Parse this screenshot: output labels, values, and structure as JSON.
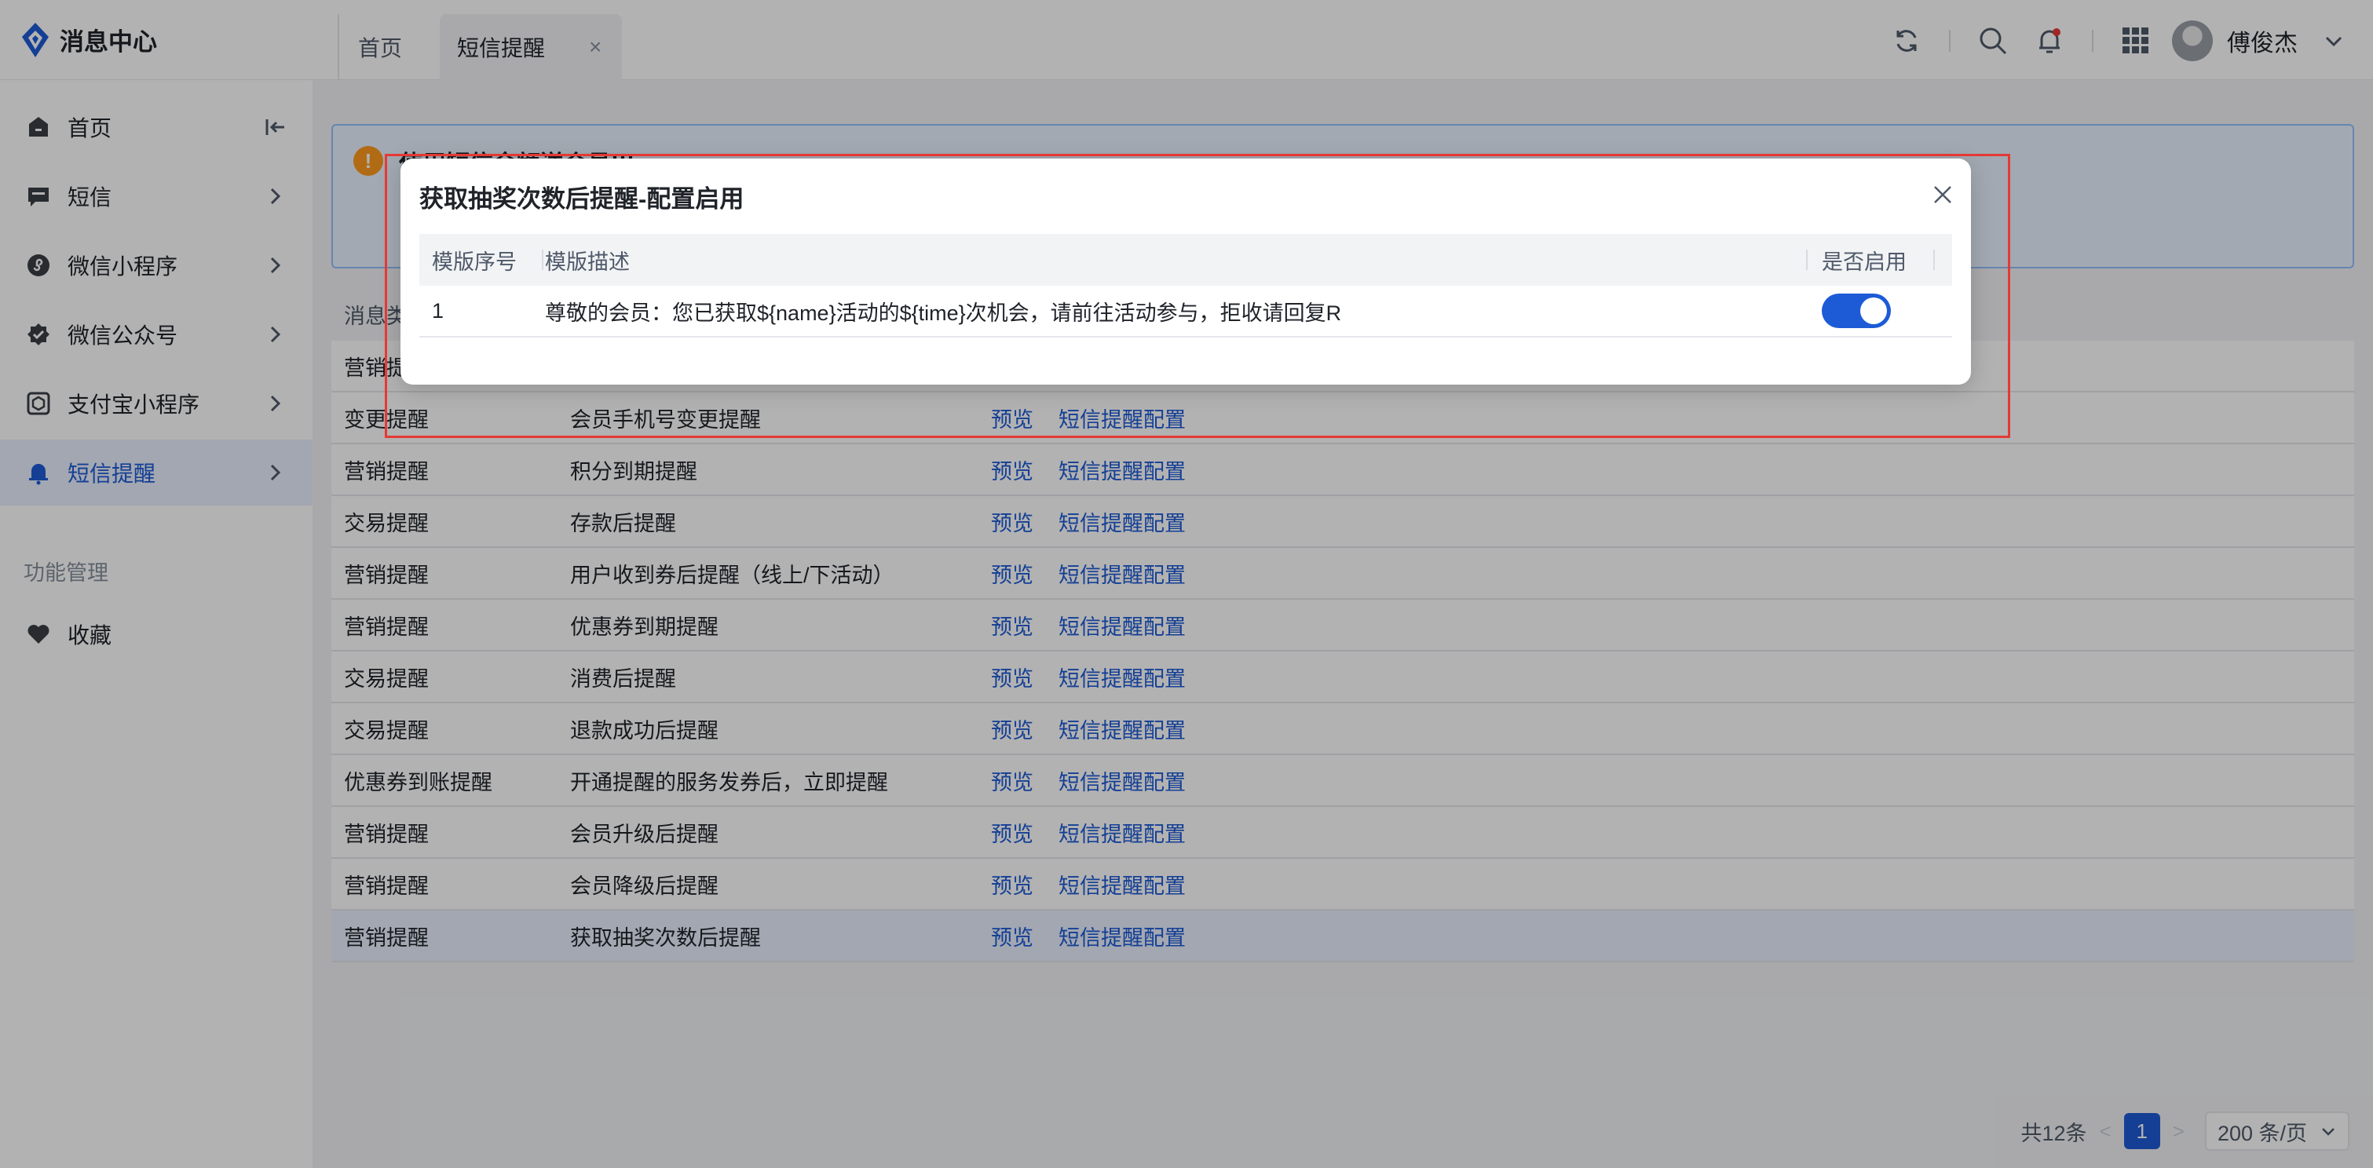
{
  "app": {
    "title": "消息中心"
  },
  "tabs": [
    {
      "label": "首页",
      "active": false
    },
    {
      "label": "短信提醒",
      "active": true,
      "close": "×"
    }
  ],
  "header": {
    "user_name": "傅俊杰",
    "icons": [
      "refresh-icon",
      "search-icon",
      "notification-bell-icon",
      "apps-grid-icon"
    ]
  },
  "sidebar": {
    "items": [
      {
        "label": "首页",
        "icon": "home-icon",
        "active": false
      },
      {
        "label": "短信",
        "icon": "message-icon",
        "active": false
      },
      {
        "label": "微信小程序",
        "icon": "mini-program-icon",
        "active": false
      },
      {
        "label": "微信公众号",
        "icon": "badge-check-icon",
        "active": false
      },
      {
        "label": "支付宝小程序",
        "icon": "alipay-box-icon",
        "active": false
      },
      {
        "label": "短信提醒",
        "icon": "bell-icon",
        "active": true
      }
    ],
    "group_label": "功能管理",
    "favorites": {
      "label": "收藏",
      "icon": "heart-icon"
    }
  },
  "main": {
    "alert": {
      "title_partial": "使用短信余额送会员!!!"
    },
    "table": {
      "header_partial": "消息类",
      "rows": [
        {
          "type": "营销提",
          "name": "",
          "preview": "",
          "config": ""
        },
        {
          "type": "变更提醒",
          "name": "会员手机号变更提醒",
          "preview": "预览",
          "config": "短信提醒配置"
        },
        {
          "type": "营销提醒",
          "name": "积分到期提醒",
          "preview": "预览",
          "config": "短信提醒配置"
        },
        {
          "type": "交易提醒",
          "name": "存款后提醒",
          "preview": "预览",
          "config": "短信提醒配置"
        },
        {
          "type": "营销提醒",
          "name": "用户收到券后提醒（线上/下活动）",
          "preview": "预览",
          "config": "短信提醒配置"
        },
        {
          "type": "营销提醒",
          "name": "优惠券到期提醒",
          "preview": "预览",
          "config": "短信提醒配置"
        },
        {
          "type": "交易提醒",
          "name": "消费后提醒",
          "preview": "预览",
          "config": "短信提醒配置"
        },
        {
          "type": "交易提醒",
          "name": "退款成功后提醒",
          "preview": "预览",
          "config": "短信提醒配置"
        },
        {
          "type": "优惠券到账提醒",
          "name": "开通提醒的服务发券后，立即提醒",
          "preview": "预览",
          "config": "短信提醒配置"
        },
        {
          "type": "营销提醒",
          "name": "会员升级后提醒",
          "preview": "预览",
          "config": "短信提醒配置"
        },
        {
          "type": "营销提醒",
          "name": "会员降级后提醒",
          "preview": "预览",
          "config": "短信提醒配置"
        },
        {
          "type": "营销提醒",
          "name": "获取抽奖次数后提醒",
          "preview": "预览",
          "config": "短信提醒配置",
          "selected": true
        }
      ]
    },
    "pagination": {
      "total": "共12条",
      "current_page": "1",
      "page_size": "200 条/页"
    }
  },
  "modal": {
    "title": "获取抽奖次数后提醒-配置启用",
    "columns": [
      "模版序号",
      "模版描述",
      "是否启用"
    ],
    "rows": [
      {
        "index": "1",
        "description": "尊敬的会员：您已获取${name}活动的${time}次机会，请前往活动参与，拒收请回复R",
        "enabled": true
      }
    ]
  },
  "colors": {
    "primary": "#1d5bd6",
    "alert_bg": "#e8f3ff",
    "warning": "#ff9a1f",
    "highlight_border": "#e53935"
  }
}
